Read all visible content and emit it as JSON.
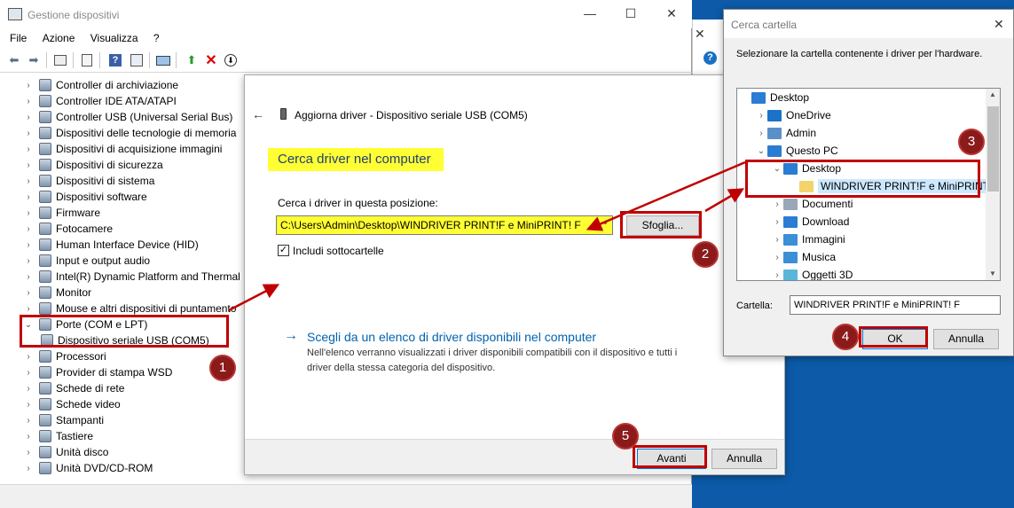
{
  "devmgr": {
    "title": "Gestione dispositivi",
    "menu": [
      "File",
      "Azione",
      "Visualizza",
      "?"
    ],
    "tree": [
      {
        "label": "Controller di archiviazione",
        "expanded": false
      },
      {
        "label": "Controller IDE ATA/ATAPI",
        "expanded": false
      },
      {
        "label": "Controller USB (Universal Serial Bus)",
        "expanded": false
      },
      {
        "label": "Dispositivi delle tecnologie di memoria",
        "expanded": false
      },
      {
        "label": "Dispositivi di acquisizione immagini",
        "expanded": false
      },
      {
        "label": "Dispositivi di sicurezza",
        "expanded": false
      },
      {
        "label": "Dispositivi di sistema",
        "expanded": false
      },
      {
        "label": "Dispositivi software",
        "expanded": false
      },
      {
        "label": "Firmware",
        "expanded": false
      },
      {
        "label": "Fotocamere",
        "expanded": false
      },
      {
        "label": "Human Interface Device (HID)",
        "expanded": false
      },
      {
        "label": "Input e output audio",
        "expanded": false
      },
      {
        "label": "Intel(R) Dynamic Platform and Thermal",
        "expanded": false
      },
      {
        "label": "Monitor",
        "expanded": false
      },
      {
        "label": "Mouse e altri dispositivi di puntamento",
        "expanded": false
      },
      {
        "label": "Porte (COM e LPT)",
        "expanded": true
      },
      {
        "label": "Dispositivo seriale USB (COM5)",
        "child": true
      },
      {
        "label": "Processori",
        "expanded": false
      },
      {
        "label": "Provider di stampa WSD",
        "expanded": false
      },
      {
        "label": "Schede di rete",
        "expanded": false
      },
      {
        "label": "Schede video",
        "expanded": false
      },
      {
        "label": "Stampanti",
        "expanded": false
      },
      {
        "label": "Tastiere",
        "expanded": false
      },
      {
        "label": "Unità disco",
        "expanded": false
      },
      {
        "label": "Unità DVD/CD-ROM",
        "expanded": false
      }
    ]
  },
  "update": {
    "header": "Aggiorna driver - Dispositivo seriale USB (COM5)",
    "heading": "Cerca driver nel computer",
    "path_label": "Cerca i driver in questa posizione:",
    "path_value": "C:\\Users\\Admin\\Desktop\\WINDRIVER PRINT!F e MiniPRINT! F",
    "browse_button": "Sfoglia...",
    "include_subfolders": "Includi sottocartelle",
    "list_link": "Scegli da un elenco di driver disponibili nel computer",
    "list_desc_1": "Nell'elenco verranno visualizzati i driver disponibili compatibili con il dispositivo e tutti i",
    "list_desc_2": "driver della stessa categoria del dispositivo.",
    "next_button": "Avanti",
    "cancel_button": "Annulla"
  },
  "browse": {
    "title": "Cerca cartella",
    "instruction": "Selezionare la cartella contenente i driver per l'hardware.",
    "tree": [
      {
        "label": "Desktop",
        "indent": 0,
        "chev": "",
        "icon": "desktop"
      },
      {
        "label": "OneDrive",
        "indent": 1,
        "chev": ">",
        "icon": "cloud"
      },
      {
        "label": "Admin",
        "indent": 1,
        "chev": ">",
        "icon": "user"
      },
      {
        "label": "Questo PC",
        "indent": 1,
        "chev": "v",
        "icon": "pc"
      },
      {
        "label": "Desktop",
        "indent": 2,
        "chev": "v",
        "icon": "desktop"
      },
      {
        "label": "WINDRIVER PRINT!F e MiniPRINT! F",
        "indent": 3,
        "chev": "",
        "icon": "folder",
        "selected": true
      },
      {
        "label": "Documenti",
        "indent": 2,
        "chev": ">",
        "icon": "docs"
      },
      {
        "label": "Download",
        "indent": 2,
        "chev": ">",
        "icon": "download"
      },
      {
        "label": "Immagini",
        "indent": 2,
        "chev": ">",
        "icon": "images"
      },
      {
        "label": "Musica",
        "indent": 2,
        "chev": ">",
        "icon": "music"
      },
      {
        "label": "Oggetti 3D",
        "indent": 2,
        "chev": ">",
        "icon": "3d"
      }
    ],
    "folder_label": "Cartella:",
    "folder_value": "WINDRIVER PRINT!F e MiniPRINT! F",
    "ok_button": "OK",
    "cancel_button": "Annulla"
  },
  "badges": [
    "1",
    "2",
    "3",
    "4",
    "5"
  ],
  "colors": {
    "annotation_red": "#c00000",
    "badge": "#8b1a1a",
    "highlight": "#ffff33",
    "link": "#0063b1"
  }
}
